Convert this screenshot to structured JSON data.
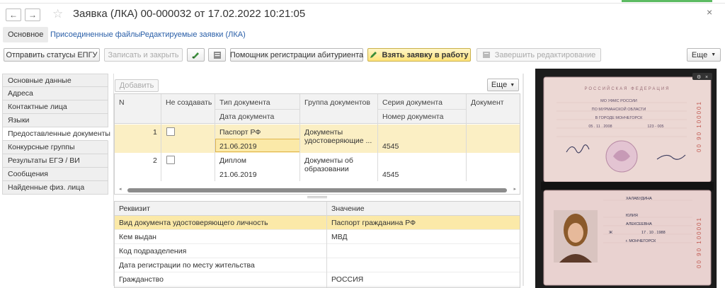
{
  "window": {
    "title": "Заявка (ЛКА) 00-000032 от 17.02.2022 10:21:05",
    "back_icon": "←",
    "forward_icon": "→",
    "star_icon": "☆",
    "close_icon": "×"
  },
  "tabs": [
    {
      "label": "Основное",
      "active": true
    },
    {
      "label": "Присоединенные файлы",
      "active": false
    },
    {
      "label": "Редактируемые заявки (ЛКА)",
      "active": false
    }
  ],
  "toolbar": {
    "send_status": "Отправить статусы ЕПГУ",
    "save_close": "Записать и закрыть",
    "assistant": "Помощник регистрации абитуриента",
    "take": "Взять заявку в работу",
    "finish": "Завершить редактирование",
    "more": "Еще"
  },
  "sidebar": {
    "items": [
      {
        "label": "Основные данные"
      },
      {
        "label": "Адреса"
      },
      {
        "label": "Контактные лица"
      },
      {
        "label": "Языки"
      },
      {
        "label": "Предоставленные документы",
        "selected": true
      },
      {
        "label": "Конкурсные группы"
      },
      {
        "label": "Результаты ЕГЭ / ВИ"
      },
      {
        "label": "Сообщения"
      },
      {
        "label": "Найденные физ. лица"
      }
    ]
  },
  "docs": {
    "add_button": "Добавить",
    "more_button": "Еще",
    "columns": {
      "n": "N",
      "not_create": "Не создавать",
      "doc_type": "Тип документа",
      "doc_date": "Дата документа",
      "doc_group": "Группа документов",
      "series": "Серия документа",
      "number": "Номер документа",
      "document": "Документ"
    },
    "rows": [
      {
        "n": "1",
        "type": "Паспорт РФ",
        "date": "21.06.2019",
        "group": "Документы удостоверяющие ...",
        "series": "",
        "number": "4545"
      },
      {
        "n": "2",
        "type": "Диплом",
        "date": "21.06.2019",
        "group_line1": "Документы об",
        "group_line2": "образовании",
        "series": "",
        "number": "4545"
      }
    ]
  },
  "props": {
    "col_attr": "Реквизит",
    "col_value": "Значение",
    "rows": [
      {
        "attr": "Вид документа удостоверяющего личность",
        "value": "Паспорт гражданина РФ"
      },
      {
        "attr": "Кем выдан",
        "value": "МВД"
      },
      {
        "attr": "Код подразделения",
        "value": ""
      },
      {
        "attr": "Дата регистрации по месту жительства",
        "value": ""
      },
      {
        "attr": "Гражданство",
        "value": "РОССИЯ"
      }
    ]
  },
  "scan": {
    "header": "РОССИЙСКАЯ ФЕДЕРАЦИЯ",
    "issued_by_1": "МО УФМС РОССИИ",
    "issued_by_2": "ПО МУРМАНСКОЙ ОБЛАСТИ",
    "issued_by_3": "В ГОРОДЕ МОНЧЕГОРСК",
    "issue_date": "05 . 11 . 2008",
    "dept_code": "123 - 005",
    "serial": "00 90 100001",
    "surname": "ХАЛАБУДИНА",
    "name": "ЮЛИЯ",
    "patronymic": "АЛЕКСЕЕВНА",
    "sex": "Ж",
    "birth_date": "17 . 10 . 1988",
    "birth_place": "г. МОНЧЕГОРСК"
  }
}
